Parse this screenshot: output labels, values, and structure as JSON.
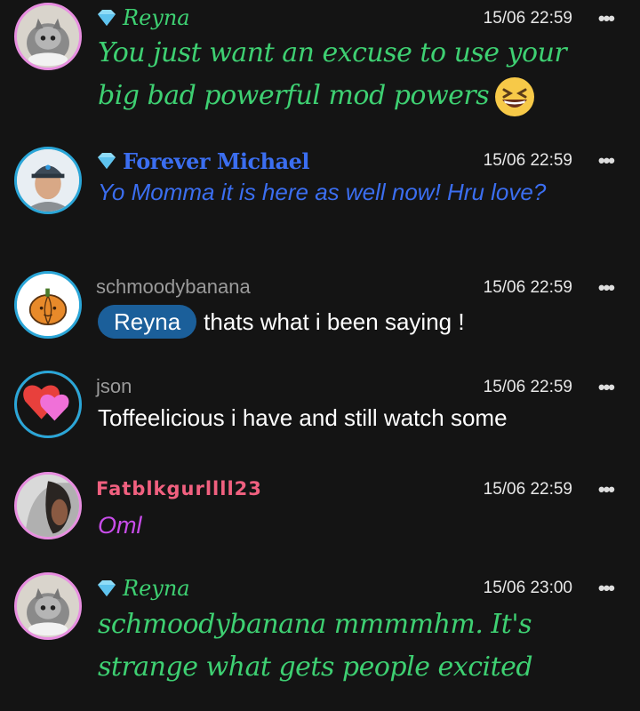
{
  "messages": [
    {
      "username": "Reyna",
      "timestamp": "15/06 22:59",
      "text": "You just want an excuse to use your big bad powerful mod powers",
      "emoji": "grinning-squinting-face",
      "colors": {
        "name": "#3ed072",
        "text": "#3ed072"
      }
    },
    {
      "username": "Forever Michael",
      "timestamp": "15/06 22:59",
      "text": "Yo Momma it is here as well now! Hru love?",
      "colors": {
        "name": "#3b6ef0",
        "text": "#3b6ef0"
      }
    },
    {
      "username": "schmoodybanana",
      "timestamp": "15/06 22:59",
      "mention": "Reyna",
      "text": "thats what i been saying !",
      "colors": {
        "name": "#9a9a9a",
        "mention_bg": "#1b5f9a"
      }
    },
    {
      "username": "json",
      "timestamp": "15/06 22:59",
      "text": "Toffeelicious i have and still watch some",
      "colors": {
        "name": "#9a9a9a"
      }
    },
    {
      "username": "Fatblkgurllll23",
      "timestamp": "15/06 22:59",
      "text": "Oml",
      "colors": {
        "name": "#f0607f",
        "text": "#c84dea"
      }
    },
    {
      "username": "Reyna",
      "timestamp": "15/06 23:00",
      "text": "schmoodybanana mmmmhm. It's strange what gets people excited",
      "colors": {
        "name": "#3ed072",
        "text": "#3ed072"
      }
    }
  ],
  "more_menu_glyph": "•••"
}
